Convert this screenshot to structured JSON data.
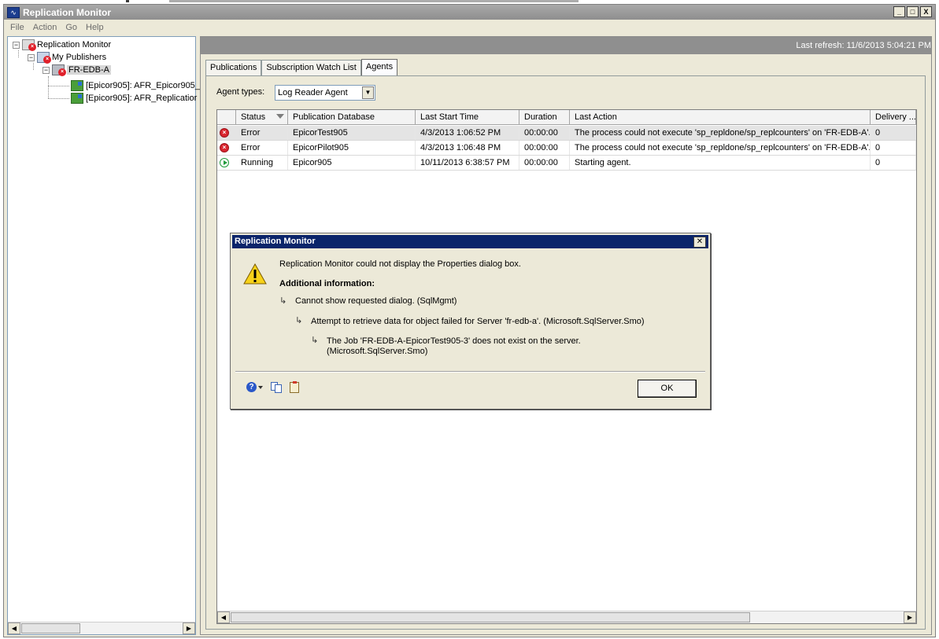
{
  "window": {
    "title": "Replication Monitor",
    "icon": "replication-monitor-icon",
    "controls": {
      "minimize": "_",
      "maximize": "□",
      "close": "X"
    }
  },
  "menu": {
    "items": [
      "File",
      "Action",
      "Go",
      "Help"
    ]
  },
  "tree": {
    "root": "Replication Monitor",
    "publishers": "My Publishers",
    "server": "FR-EDB-A",
    "publications": [
      "[Epicor905]: AFR_Epicor905_",
      "[Epicor905]: AFR_Replicatior"
    ],
    "expander_minus": "−"
  },
  "main": {
    "last_refresh": "Last refresh: 11/6/2013 5:04:21 PM",
    "tabs": [
      "Publications",
      "Subscription Watch List",
      "Agents"
    ],
    "active_tab": "Agents",
    "agent_types_label": "Agent types:",
    "agent_type_selected": "Log Reader Agent",
    "columns": [
      "Status",
      "Publication Database",
      "Last Start Time",
      "Duration",
      "Last Action",
      "Delivery ..."
    ],
    "rows": [
      {
        "status_icon": "error-icon",
        "status": "Error",
        "db": "EpicorTest905",
        "start": "4/3/2013 1:06:52 PM",
        "duration": "00:00:00",
        "action": "The process could not execute 'sp_repldone/sp_replcounters' on 'FR-EDB-A'.",
        "delivery": "0"
      },
      {
        "status_icon": "error-icon",
        "status": "Error",
        "db": "EpicorPilot905",
        "start": "4/3/2013 1:06:48 PM",
        "duration": "00:00:00",
        "action": "The process could not execute 'sp_repldone/sp_replcounters' on 'FR-EDB-A'.",
        "delivery": "0"
      },
      {
        "status_icon": "running-icon",
        "status": "Running",
        "db": "Epicor905",
        "start": "10/11/2013 6:38:57 PM",
        "duration": "00:00:00",
        "action": "Starting agent.",
        "delivery": "0"
      }
    ]
  },
  "dialog": {
    "title": "Replication Monitor",
    "message": "Replication Monitor could not display the Properties dialog box.",
    "additional_info": "Additional information:",
    "details": [
      "Cannot show requested dialog. (SqlMgmt)",
      "Attempt to retrieve data for object failed for Server 'fr-edb-a'.  (Microsoft.SqlServer.Smo)",
      "The Job 'FR-EDB-A-EpicorTest905-3' does not exist on the server.",
      "(Microsoft.SqlServer.Smo)"
    ],
    "arrow_glyph": "↳",
    "ok_label": "OK",
    "close_label": "✕"
  }
}
